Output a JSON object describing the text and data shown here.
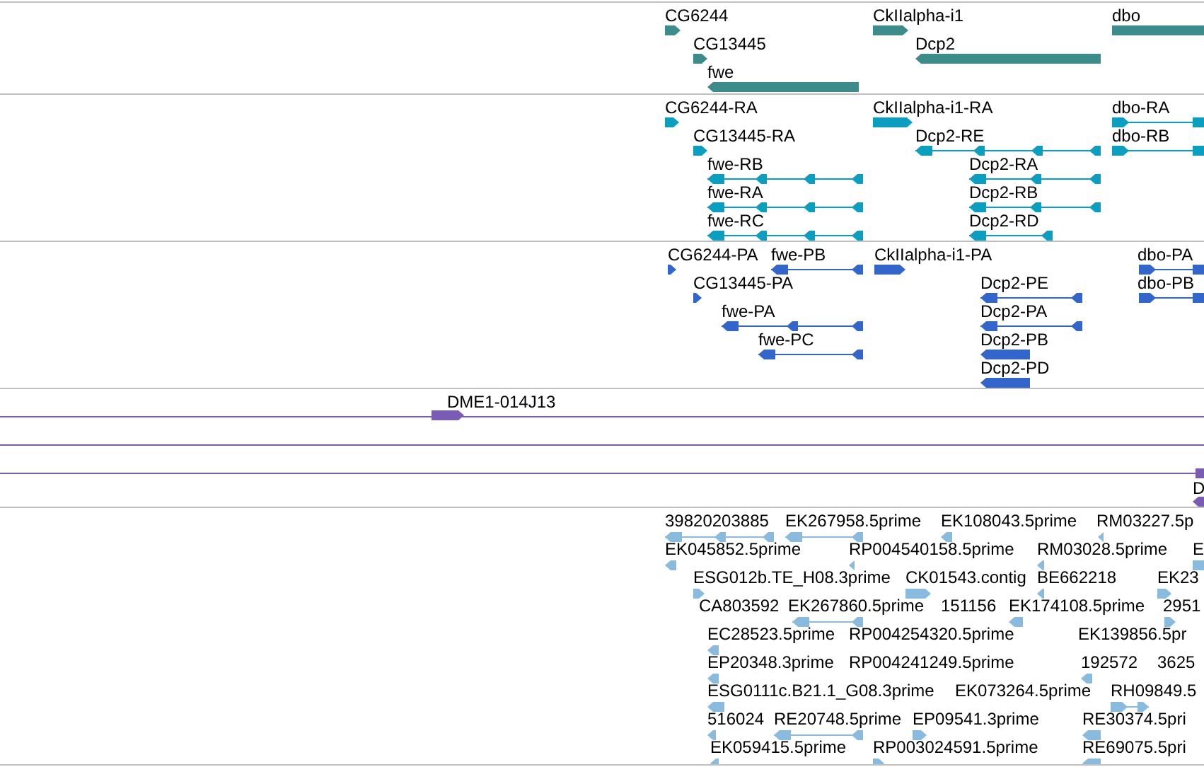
{
  "tracks": [
    {
      "kind": "gene",
      "color": "#3d8c8c",
      "features": [
        {
          "label": "CG6244",
          "reverse": false
        },
        {
          "label": "CkIIalpha-i1",
          "reverse": false
        },
        {
          "label": "dbo",
          "reverse": false
        },
        {
          "label": "CG13445",
          "reverse": false
        },
        {
          "label": "Dcp2",
          "reverse": true
        },
        {
          "label": "fwe",
          "reverse": true
        }
      ]
    },
    {
      "kind": "mrna",
      "color": "#0a9fc0",
      "features": [
        {
          "label": "CG6244-RA",
          "reverse": false
        },
        {
          "label": "CkIIalpha-i1-RA",
          "reverse": false
        },
        {
          "label": "dbo-RA",
          "reverse": false
        },
        {
          "label": "CG13445-RA",
          "reverse": false
        },
        {
          "label": "Dcp2-RE",
          "reverse": true
        },
        {
          "label": "dbo-RB",
          "reverse": false
        },
        {
          "label": "fwe-RB",
          "reverse": true
        },
        {
          "label": "Dcp2-RA",
          "reverse": true
        },
        {
          "label": "fwe-RA",
          "reverse": true
        },
        {
          "label": "Dcp2-RB",
          "reverse": true
        },
        {
          "label": "fwe-RC",
          "reverse": true
        },
        {
          "label": "Dcp2-RD",
          "reverse": true
        }
      ]
    },
    {
      "kind": "protein",
      "color": "#3366cc",
      "features": [
        {
          "label": "CG6244-PA",
          "reverse": false
        },
        {
          "label": "fwe-PB",
          "reverse": true
        },
        {
          "label": "CkIIalpha-i1-PA",
          "reverse": false
        },
        {
          "label": "dbo-PA",
          "reverse": false
        },
        {
          "label": "CG13445-PA",
          "reverse": false
        },
        {
          "label": "Dcp2-PE",
          "reverse": true
        },
        {
          "label": "dbo-PB",
          "reverse": false
        },
        {
          "label": "fwe-PA",
          "reverse": true
        },
        {
          "label": "Dcp2-PA",
          "reverse": true
        },
        {
          "label": "fwe-PC",
          "reverse": true
        },
        {
          "label": "Dcp2-PB",
          "reverse": true
        },
        {
          "label": "Dcp2-PD",
          "reverse": true
        }
      ]
    },
    {
      "kind": "clone",
      "color": "#7a5cb5",
      "features": [
        {
          "label": "DME1-014J13",
          "reverse": false
        },
        {
          "label": "D",
          "reverse": true
        }
      ]
    },
    {
      "kind": "est",
      "color": "#88bbde",
      "features": [
        {
          "label": "39820203885",
          "reverse": true
        },
        {
          "label": "EK267958.5prime",
          "reverse": true
        },
        {
          "label": "EK108043.5prime",
          "reverse": true
        },
        {
          "label": "RM03227.5p",
          "reverse": true
        },
        {
          "label": "EK045852.5prime",
          "reverse": true
        },
        {
          "label": "RP004540158.5prime",
          "reverse": true
        },
        {
          "label": "RM03028.5prime",
          "reverse": true
        },
        {
          "label": "E",
          "reverse": false
        },
        {
          "label": "ESG012b.TE_H08.3prime",
          "reverse": false
        },
        {
          "label": "CK01543.contig",
          "reverse": false
        },
        {
          "label": "BE662218",
          "reverse": true
        },
        {
          "label": "EK23",
          "reverse": false
        },
        {
          "label": "CA803592"
        },
        {
          "label": "EK267860.5prime",
          "reverse": true
        },
        {
          "label": "151156"
        },
        {
          "label": "EK174108.5prime",
          "reverse": true
        },
        {
          "label": "2951",
          "reverse": false
        },
        {
          "label": "EC28523.5prime",
          "reverse": true
        },
        {
          "label": "RP004254320.5prime"
        },
        {
          "label": "EK139856.5pr"
        },
        {
          "label": "EP20348.3prime",
          "reverse": true
        },
        {
          "label": "RP004241249.5prime"
        },
        {
          "label": "192572",
          "reverse": true
        },
        {
          "label": "3625"
        },
        {
          "label": "ESG0111c.B21.1_G08.3prime",
          "reverse": true
        },
        {
          "label": "EK073264.5prime"
        },
        {
          "label": "RH09849.5",
          "reverse": false
        },
        {
          "label": "516024",
          "reverse": true
        },
        {
          "label": "RE20748.5prime",
          "reverse": true
        },
        {
          "label": "EP09541.3prime",
          "reverse": false
        },
        {
          "label": "RE30374.5pri",
          "reverse": true
        },
        {
          "label": "EK059415.5prime",
          "reverse": true
        },
        {
          "label": "RP003024591.5prime",
          "reverse": false
        },
        {
          "label": "RE69075.5pri",
          "reverse": true
        }
      ]
    }
  ]
}
